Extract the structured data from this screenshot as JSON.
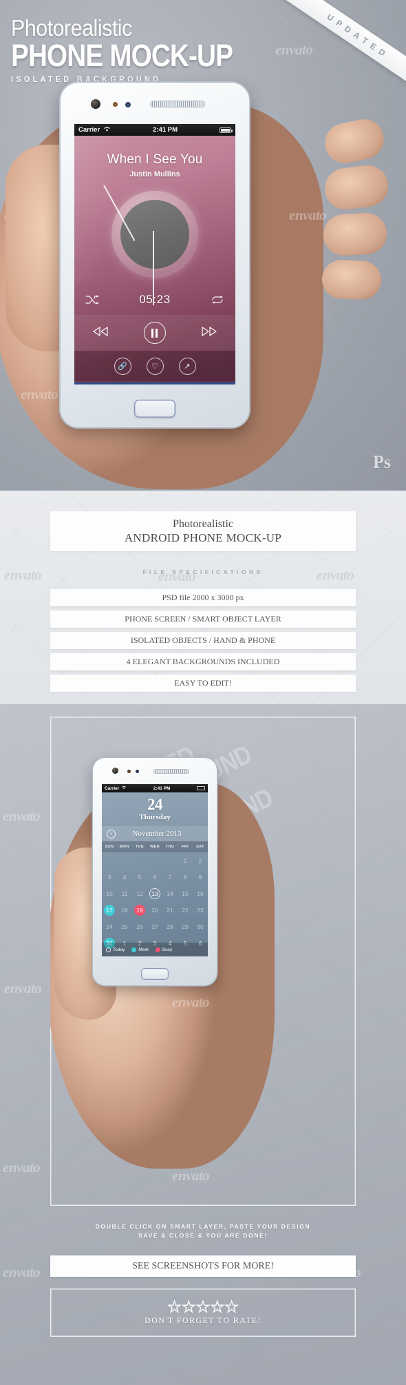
{
  "hero": {
    "title_line1": "Photorealistic",
    "title_line2": "PHONE MOCK-UP",
    "title_line3": "ISOLATED BACKGROUND",
    "ribbon_label": "UPDATED",
    "ps_badge": "Ps"
  },
  "phone_top": {
    "status": {
      "carrier": "Carrier",
      "time": "2:41 PM"
    },
    "player": {
      "song_title": "When I See You",
      "artist": "Justin Mullins",
      "elapsed": "05:23",
      "shuffle_icon": "shuffle-icon",
      "repeat_icon": "repeat-icon",
      "prev_icon": "previous-track-icon",
      "pause_icon": "pause-icon",
      "next_icon": "next-track-icon",
      "link_icon": "link-icon",
      "heart_icon": "heart-icon",
      "share_icon": "share-icon"
    }
  },
  "mid": {
    "card_title_a": "Photorealistic",
    "card_title_b": "ANDROID PHONE MOCK-UP",
    "specs_label": "FILE SPECIFICATIONS",
    "specs": [
      "PSD file 2000 x 3000 px",
      "PHONE SCREEN / SMART OBJECT LAYER",
      "ISOLATED OBJECTS / HAND & PHONE",
      "4 ELEGANT BACKGROUNDS INCLUDED",
      "EASY TO EDIT!"
    ]
  },
  "bottom": {
    "watermark_lines": [
      "ISOLATED",
      "BACKGROUND",
      "ISOLATED",
      "BACKGROUND"
    ],
    "instruction_line1": "DOUBLE CLICK ON SMART LAYER, PASTE YOUR DESIGN",
    "instruction_line2": "SAVE & CLOSE & YOU ARE DONE!",
    "see_more": "SEE SCREENSHOTS FOR MORE!",
    "rate_text": "DON'T FORGET TO RATE!",
    "star_count": 5
  },
  "phone_bottom": {
    "status": {
      "carrier": "Carrier",
      "time": "2:41 PM"
    },
    "calendar": {
      "day_number": "24",
      "weekday": "Thursday",
      "month_year": "November 2013",
      "prev_icon": "chevron-left-icon",
      "dow": [
        "SUN",
        "MON",
        "TUE",
        "WED",
        "THU",
        "FRI",
        "SAT"
      ],
      "weeks": [
        [
          {
            "n": "",
            "t": "blank"
          },
          {
            "n": "",
            "t": "blank"
          },
          {
            "n": "",
            "t": "blank"
          },
          {
            "n": "",
            "t": "blank"
          },
          {
            "n": "",
            "t": "blank"
          },
          {
            "n": "1",
            "t": "normal"
          },
          {
            "n": "2",
            "t": "normal"
          }
        ],
        [
          {
            "n": "3",
            "t": "normal"
          },
          {
            "n": "4",
            "t": "normal"
          },
          {
            "n": "5",
            "t": "normal"
          },
          {
            "n": "6",
            "t": "normal"
          },
          {
            "n": "7",
            "t": "normal"
          },
          {
            "n": "8",
            "t": "normal"
          },
          {
            "n": "9",
            "t": "normal"
          }
        ],
        [
          {
            "n": "10",
            "t": "normal"
          },
          {
            "n": "11",
            "t": "normal"
          },
          {
            "n": "12",
            "t": "normal"
          },
          {
            "n": "13",
            "t": "today"
          },
          {
            "n": "14",
            "t": "normal"
          },
          {
            "n": "15",
            "t": "normal"
          },
          {
            "n": "16",
            "t": "normal"
          }
        ],
        [
          {
            "n": "17",
            "t": "meet"
          },
          {
            "n": "18",
            "t": "normal"
          },
          {
            "n": "19",
            "t": "busy"
          },
          {
            "n": "20",
            "t": "normal"
          },
          {
            "n": "21",
            "t": "normal"
          },
          {
            "n": "22",
            "t": "normal"
          },
          {
            "n": "23",
            "t": "normal"
          }
        ],
        [
          {
            "n": "24",
            "t": "normal"
          },
          {
            "n": "25",
            "t": "normal"
          },
          {
            "n": "26",
            "t": "normal"
          },
          {
            "n": "27",
            "t": "normal"
          },
          {
            "n": "28",
            "t": "normal"
          },
          {
            "n": "29",
            "t": "normal"
          },
          {
            "n": "30",
            "t": "normal"
          }
        ],
        [
          {
            "n": "31",
            "t": "meet"
          },
          {
            "n": "1",
            "t": "out"
          },
          {
            "n": "2",
            "t": "out"
          },
          {
            "n": "3",
            "t": "out"
          },
          {
            "n": "4",
            "t": "out"
          },
          {
            "n": "5",
            "t": "out"
          },
          {
            "n": "6",
            "t": "out"
          }
        ]
      ],
      "legend": [
        {
          "label": "Today",
          "color": "hollow"
        },
        {
          "label": "Meet",
          "color": "#3ecfd6"
        },
        {
          "label": "Busy",
          "color": "#f4526a"
        }
      ]
    }
  },
  "colors": {
    "meet": "#3ecfd6",
    "busy": "#f4526a",
    "player_accent": "#2b4d8c",
    "card_bg": "#fdfdfe"
  },
  "watermark": {
    "text": "envato"
  }
}
